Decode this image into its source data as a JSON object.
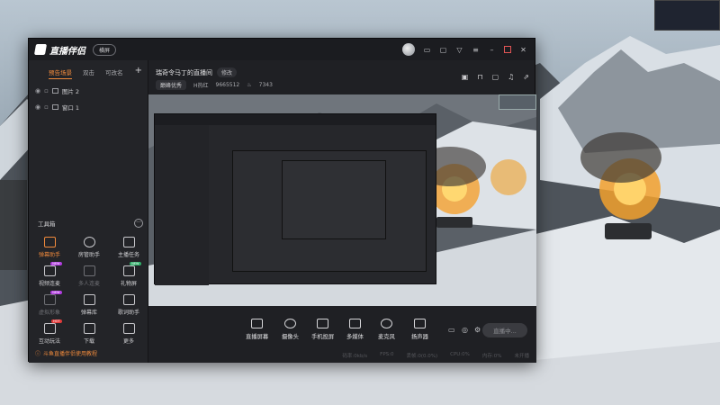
{
  "colors": {
    "accent": "#f08a3c",
    "window_bg": "#1f2024",
    "sidebar_bg": "#232428"
  },
  "app": {
    "name": "直播伴侣",
    "mode_label": "横屏"
  },
  "sidebar": {
    "tabs": [
      {
        "label": "预告场景",
        "active": true
      },
      {
        "label": "双击",
        "active": false
      },
      {
        "label": "可改名",
        "active": false
      }
    ],
    "add_icon": "plus-icon",
    "sources": [
      {
        "label": "图片 2"
      },
      {
        "label": "窗口 1"
      }
    ],
    "toolbox_title": "工具箱",
    "tools": [
      {
        "label": "弹幕助手",
        "icon": "danmu-icon",
        "state": "hot"
      },
      {
        "label": "房管助手",
        "icon": "user-icon",
        "state": "normal"
      },
      {
        "label": "主播任务",
        "icon": "task-icon",
        "state": "normal"
      },
      {
        "label": "视频连麦",
        "icon": "video-link-icon",
        "state": "normal",
        "badge": "NEW",
        "badge_color": "purple"
      },
      {
        "label": "多人连麦",
        "icon": "multi-link-icon",
        "state": "dim"
      },
      {
        "label": "礼物屏",
        "icon": "gift-icon",
        "state": "normal",
        "badge": "NEW",
        "badge_color": "green"
      },
      {
        "label": "虚拟形象",
        "icon": "avatar-icon",
        "state": "dim",
        "badge": "NEW",
        "badge_color": "purple"
      },
      {
        "label": "弹幕库",
        "icon": "library-icon",
        "state": "normal"
      },
      {
        "label": "歌词助手",
        "icon": "lyrics-icon",
        "state": "normal"
      },
      {
        "label": "互动玩法",
        "icon": "game-icon",
        "state": "normal",
        "badge": "HOT",
        "badge_color": "red"
      },
      {
        "label": "下载",
        "icon": "download-icon",
        "state": "normal"
      },
      {
        "label": "更多",
        "icon": "more-icon",
        "state": "normal"
      }
    ],
    "help_text": "斗鱼直播伴侣使用教程"
  },
  "header": {
    "room_title": "瑞奇令马丁的直播间",
    "edit_label": "修改",
    "category": "巅峰优秀",
    "hot_label": "H热红",
    "hot_value": "9665512",
    "fans_value": "7343"
  },
  "bottom": {
    "buttons": [
      {
        "label": "直播屏幕",
        "icon": "screen-icon"
      },
      {
        "label": "摄像头",
        "icon": "camera-icon"
      },
      {
        "label": "手机投屏",
        "icon": "phone-cast-icon"
      },
      {
        "label": "多媒体",
        "icon": "media-icon"
      },
      {
        "label": "麦克风",
        "icon": "mic-icon"
      },
      {
        "label": "扬声器",
        "icon": "speaker-icon"
      }
    ],
    "start_label": "直播中...",
    "status": [
      "码率:0kb/s",
      "FPS:0",
      "丢帧:0(0.0%)",
      "CPU:0%",
      "内存:0%",
      "未开播"
    ]
  }
}
